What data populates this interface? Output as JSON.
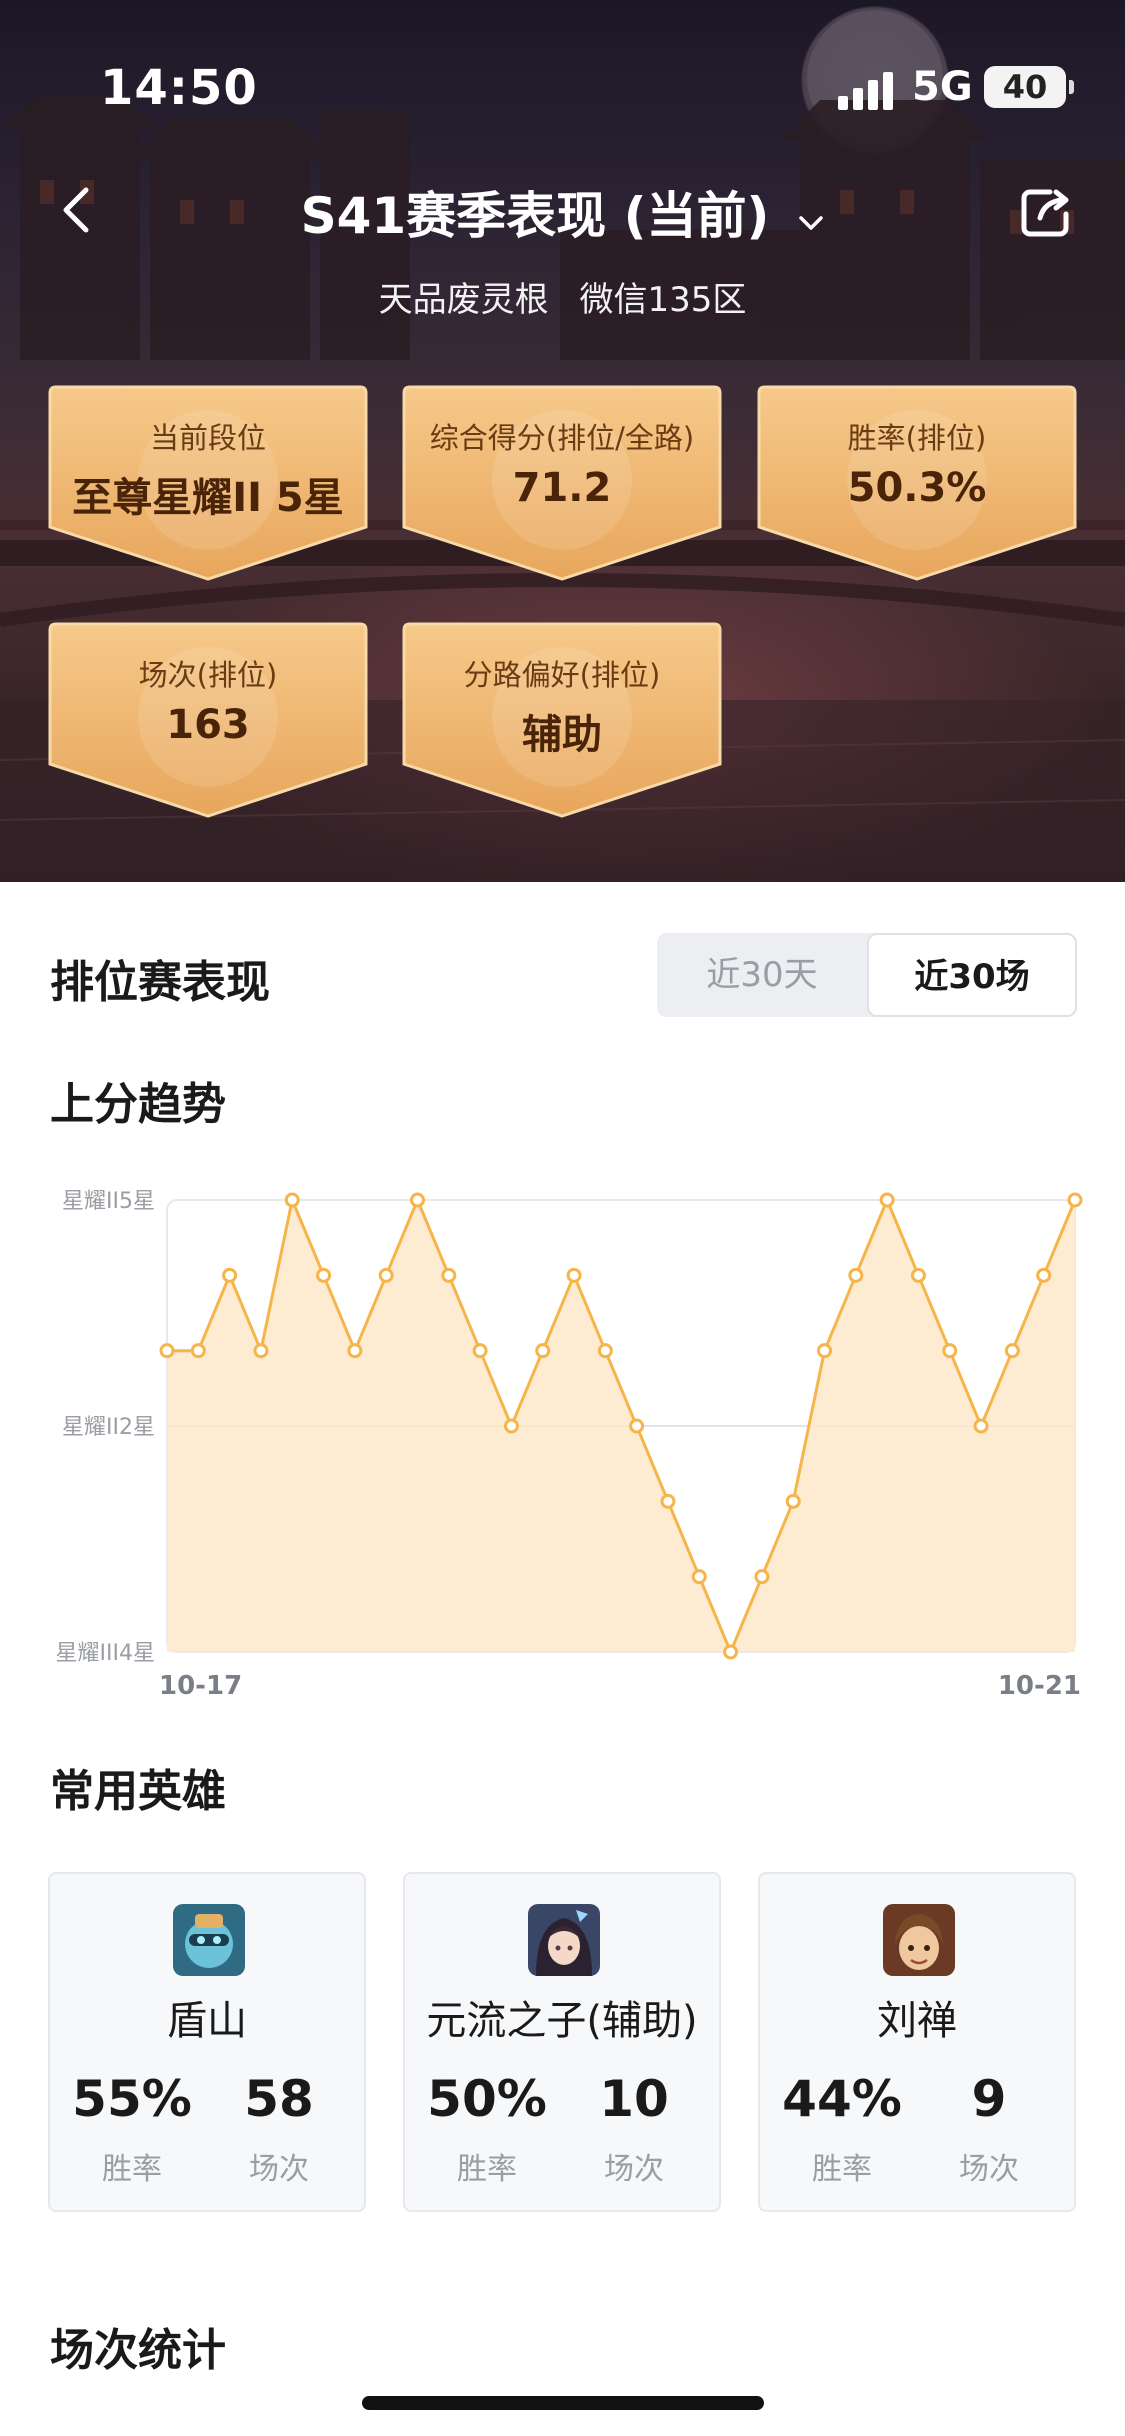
{
  "status_bar": {
    "time": "14:50",
    "network": "5G",
    "battery": "40"
  },
  "nav": {
    "title": "S41赛季表现 (当前)",
    "player_name": "天品废灵根",
    "server": "微信135区"
  },
  "badges": [
    {
      "label": "当前段位",
      "value": "至尊星耀II 5星"
    },
    {
      "label": "综合得分(排位/全路)",
      "value": "71.2"
    },
    {
      "label": "胜率(排位)",
      "value": "50.3%"
    },
    {
      "label": "场次(排位)",
      "value": "163"
    },
    {
      "label": "分路偏好(排位)",
      "value": "辅助"
    }
  ],
  "ranked": {
    "title": "排位赛表现",
    "tabs": [
      {
        "label": "近30天",
        "active": false
      },
      {
        "label": "近30场",
        "active": true
      }
    ]
  },
  "trend": {
    "title": "上分趋势"
  },
  "chart_data": {
    "type": "area",
    "y_tick_labels": [
      "星耀III4星",
      "星耀II2星",
      "星耀II5星"
    ],
    "y_ticks": [
      0,
      3,
      6
    ],
    "ylim": [
      0,
      6
    ],
    "x_tick_labels": [
      "10-17",
      "10-21"
    ],
    "values": [
      4,
      4,
      5,
      4,
      6,
      5,
      4,
      5,
      6,
      5,
      4,
      3,
      4,
      5,
      4,
      3,
      2,
      1,
      0,
      1,
      2,
      4,
      5,
      6,
      5,
      4,
      3,
      4,
      5,
      6
    ],
    "line_color": "#f5b54a",
    "fill_color": "#fde9c9"
  },
  "heroes_section": {
    "title": "常用英雄"
  },
  "heroes": [
    {
      "name": "盾山",
      "win_rate": "55%",
      "win_rate_label": "胜率",
      "games": "58",
      "games_label": "场次",
      "icon": "dunshan-avatar"
    },
    {
      "name": "元流之子(辅助)",
      "win_rate": "50%",
      "win_rate_label": "胜率",
      "games": "10",
      "games_label": "场次",
      "icon": "yuanliu-avatar"
    },
    {
      "name": "刘禅",
      "win_rate": "44%",
      "win_rate_label": "胜率",
      "games": "9",
      "games_label": "场次",
      "icon": "liushan-avatar"
    }
  ],
  "match_stats": {
    "title": "场次统计"
  },
  "colors": {
    "badge_gold": "#f0b46a",
    "badge_text": "#4a2408",
    "accent_line": "#f5b54a"
  }
}
